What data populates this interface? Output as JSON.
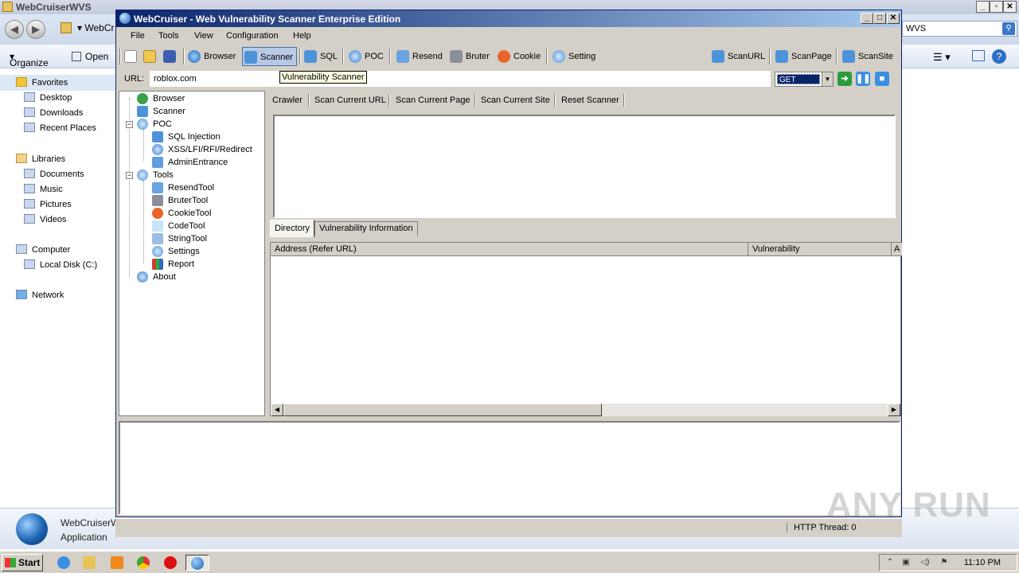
{
  "explorer": {
    "title": "WebCruiserWVS",
    "address": "WebCr",
    "search": "WVS",
    "toolbar": {
      "organize": "Organize",
      "open": "Open"
    },
    "nav": {
      "favorites": "Favorites",
      "desktop": "Desktop",
      "downloads": "Downloads",
      "recent": "Recent Places",
      "libraries": "Libraries",
      "documents": "Documents",
      "music": "Music",
      "pictures": "Pictures",
      "videos": "Videos",
      "computer": "Computer",
      "local_disk": "Local Disk (C:)",
      "network": "Network"
    },
    "details": {
      "name": "WebCruiserW",
      "kind": "Application"
    }
  },
  "app": {
    "title": "WebCruiser - Web Vulnerability Scanner Enterprise Edition",
    "menu": [
      "File",
      "Tools",
      "View",
      "Configuration",
      "Help"
    ],
    "toolbar": {
      "browser": "Browser",
      "scanner": "Scanner",
      "sql": "SQL",
      "poc": "POC",
      "resend": "Resend",
      "bruter": "Bruter",
      "cookie": "Cookie",
      "setting": "Setting",
      "scanurl": "ScanURL",
      "scanpage": "ScanPage",
      "scansite": "ScanSite"
    },
    "url_label": "URL:",
    "url_value": "roblox.com",
    "tooltip": "Vulnerability Scanner",
    "method": "GET",
    "tree": {
      "browser": "Browser",
      "scanner": "Scanner",
      "poc": "POC",
      "sql_injection": "SQL Injection",
      "xss": "XSS/LFI/RFI/Redirect",
      "admin": "AdminEntrance",
      "tools": "Tools",
      "resend": "ResendTool",
      "bruter": "BruterTool",
      "cookie": "CookieTool",
      "code": "CodeTool",
      "string": "StringTool",
      "settings": "Settings",
      "report": "Report",
      "about": "About"
    },
    "scan_actions": {
      "crawler": "Crawler",
      "scan_url": "Scan Current URL",
      "scan_page": "Scan Current Page",
      "scan_site": "Scan Current Site",
      "reset": "Reset Scanner"
    },
    "tabs": {
      "directory": "Directory",
      "vuln_info": "Vulnerability Information"
    },
    "columns": {
      "address": "Address (Refer URL)",
      "vulnerability": "Vulnerability",
      "extra": "A"
    },
    "status": {
      "http_thread": "HTTP Thread: 0"
    }
  },
  "watermark": "ANY RUN",
  "taskbar": {
    "start": "Start",
    "clock": "11:10 PM"
  }
}
